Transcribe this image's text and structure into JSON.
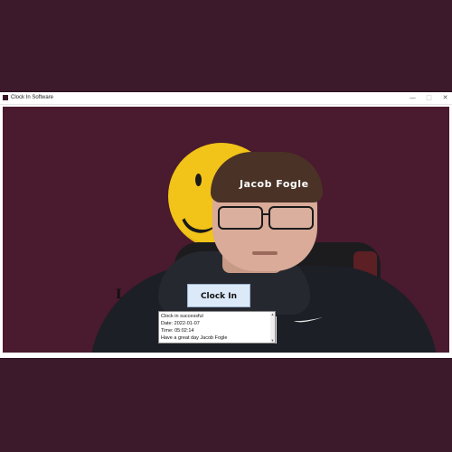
{
  "window": {
    "title": "Clock In Software",
    "buttons": {
      "minimize": "—",
      "maximize": "□",
      "close": "✕"
    }
  },
  "camera": {
    "overlay_name": "Jacob Fogle"
  },
  "controls": {
    "clock_in_label": "Clock In"
  },
  "log": {
    "lines": [
      "Clock in successful",
      " Date: 2022-01-07",
      "Time: 05:02:14",
      "Have a great day Jacob Fogle"
    ]
  },
  "colors": {
    "background": "#3d1a2b",
    "client_background": "#4a1a2e",
    "smiley": "#f2c318",
    "button_fill": "#dbe9f8"
  }
}
